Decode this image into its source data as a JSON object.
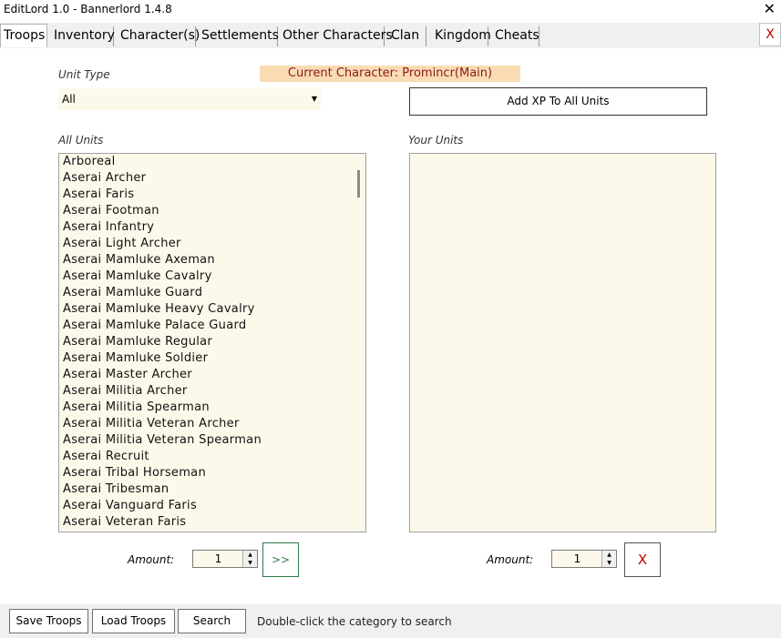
{
  "window": {
    "title": "EditLord 1.0 - Bannerlord 1.4.8",
    "close_glyph": "✕"
  },
  "tabs": [
    {
      "label": "Troops"
    },
    {
      "label": "Inventory"
    },
    {
      "label": "Character(s)"
    },
    {
      "label": "Settlements"
    },
    {
      "label": "Other Characters"
    },
    {
      "label": "Clan"
    },
    {
      "label": "Kingdom"
    },
    {
      "label": "Cheats"
    }
  ],
  "tab_close": "X",
  "unit_type": {
    "label": "Unit Type",
    "selected": "All"
  },
  "current_character": "Current Character: Promincr(Main)",
  "add_xp_label": "Add XP To All Units",
  "all_units": {
    "label": "All Units",
    "items": [
      "Arboreal",
      "Aserai Archer",
      "Aserai Faris",
      "Aserai Footman",
      "Aserai Infantry",
      "Aserai Light Archer",
      "Aserai Mamluke Axeman",
      "Aserai Mamluke Cavalry",
      "Aserai Mamluke Guard",
      "Aserai Mamluke Heavy Cavalry",
      "Aserai Mamluke Palace Guard",
      "Aserai Mamluke Regular",
      "Aserai Mamluke Soldier",
      "Aserai Master Archer",
      "Aserai Militia Archer",
      "Aserai Militia Spearman",
      "Aserai Militia Veteran Archer",
      "Aserai Militia Veteran Spearman",
      "Aserai Recruit",
      "Aserai Tribal Horseman",
      "Aserai Tribesman",
      "Aserai Vanguard Faris",
      "Aserai Veteran Faris"
    ]
  },
  "your_units": {
    "label": "Your Units",
    "items": []
  },
  "left_amount": {
    "label": "Amount:",
    "value": "1"
  },
  "right_amount": {
    "label": "Amount:",
    "value": "1"
  },
  "transfer_label": ">>",
  "remove_label": "X",
  "bottom": {
    "save": "Save Troops",
    "load": "Load Troops",
    "search": "Search",
    "hint": "Double-click the category to search"
  }
}
